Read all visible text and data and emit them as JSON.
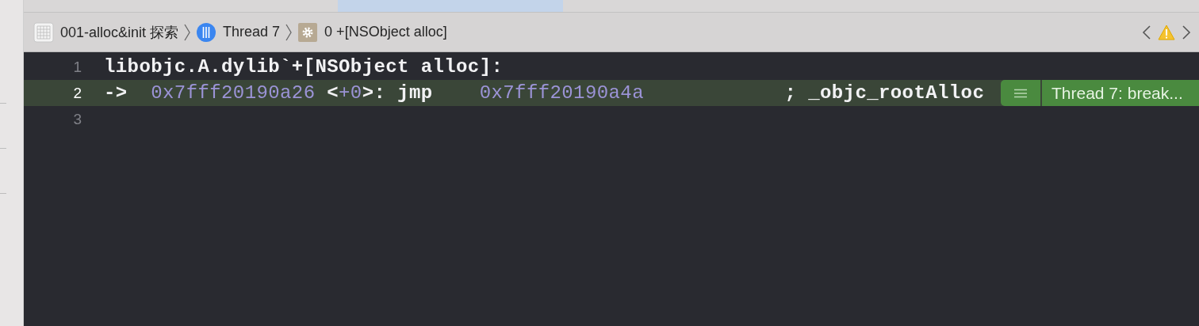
{
  "breadcrumbs": [
    {
      "kind": "project",
      "label": "001-alloc&init 探索"
    },
    {
      "kind": "thread",
      "label": "Thread 7"
    },
    {
      "kind": "frame",
      "label": "0 +[NSObject alloc]"
    }
  ],
  "editor": {
    "lines": [
      {
        "number": "1",
        "current": false,
        "tokens": [
          {
            "kind": "plain",
            "text": "libobjc.A.dylib`+[NSObject alloc]:"
          }
        ]
      },
      {
        "number": "2",
        "current": true,
        "tokens": [
          {
            "kind": "plain",
            "text": "->  "
          },
          {
            "kind": "number",
            "text": "0x7fff20190a26"
          },
          {
            "kind": "plain",
            "text": " <"
          },
          {
            "kind": "number",
            "text": "+0"
          },
          {
            "kind": "plain",
            "text": ">: jmp    "
          },
          {
            "kind": "number",
            "text": "0x7fff20190a4a"
          },
          {
            "kind": "plain",
            "text": "            ; _objc_rootAlloc"
          }
        ],
        "annotation": {
          "label": "Thread 7: break..."
        }
      },
      {
        "number": "3",
        "current": false
      }
    ]
  }
}
